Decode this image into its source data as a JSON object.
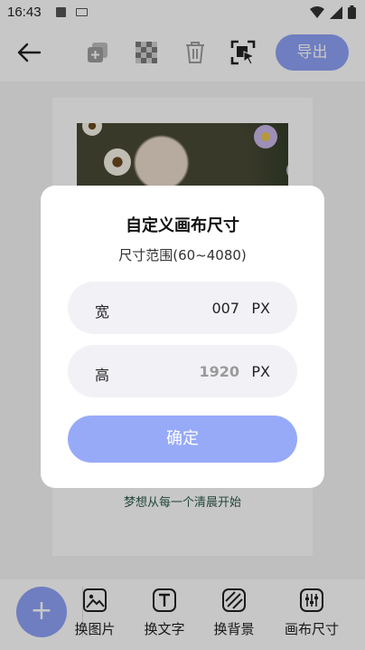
{
  "status_bar": {
    "time": "16:43"
  },
  "toolbar": {
    "export_label": "导出"
  },
  "canvas": {
    "caption": "梦想从每一个清晨开始"
  },
  "bottom_bar": {
    "add_label": "+",
    "items": [
      {
        "label": "换图片",
        "icon": "image-icon"
      },
      {
        "label": "换文字",
        "icon": "text-icon"
      },
      {
        "label": "换背景",
        "icon": "background-icon"
      },
      {
        "label": "画布尺寸",
        "icon": "canvas-size-icon"
      }
    ]
  },
  "dialog": {
    "title": "自定义画布尺寸",
    "subtitle": "尺寸范围(60~4080)",
    "width": {
      "label": "宽",
      "value": "007",
      "unit": "PX"
    },
    "height": {
      "label": "高",
      "placeholder": "1920",
      "unit": "PX"
    },
    "confirm_label": "确定"
  },
  "colors": {
    "accent": "#8fa2f7",
    "confirm": "#97aaf8",
    "field_bg": "#f2f1f6"
  }
}
